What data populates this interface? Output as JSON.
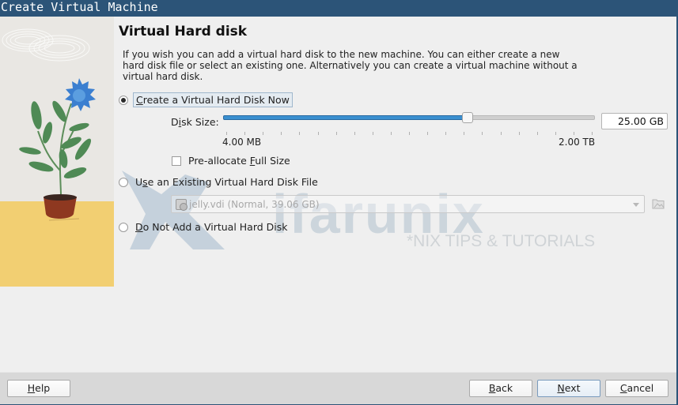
{
  "window": {
    "title": "Create Virtual Machine"
  },
  "page": {
    "title": "Virtual Hard disk",
    "description": "If you wish you can add a virtual hard disk to the new machine. You can either create a new hard disk file or select an existing one. Alternatively you can create a virtual machine without a virtual hard disk."
  },
  "options": {
    "create_new": {
      "label_mnemonic": "C",
      "label_rest": "reate a Virtual Hard Disk Now",
      "selected": true
    },
    "use_existing": {
      "label_pre": "U",
      "label_mnemonic": "s",
      "label_rest": "e an Existing Virtual Hard Disk File",
      "selected": false
    },
    "no_disk": {
      "label_mnemonic": "D",
      "label_rest": "o Not Add a Virtual Hard Disk",
      "selected": false
    }
  },
  "disk_size": {
    "label_pre": "D",
    "label_mnemonic": "i",
    "label_rest": "sk Size:",
    "value": "25.00 GB",
    "slider_fraction": 0.655,
    "min_label": "4.00 MB",
    "max_label": "2.00 TB",
    "tick_count": 20
  },
  "preallocate": {
    "label_pre": "Pre-allocate ",
    "label_mnemonic": "F",
    "label_rest": "ull Size",
    "checked": false
  },
  "existing_disk": {
    "selected": "jelly.vdi (Normal, 39.06 GB)",
    "enabled": false
  },
  "watermark": {
    "brand": "ifarunix",
    "tagline": "*NIX TIPS & TUTORIALS"
  },
  "buttons": {
    "help": {
      "mnemonic": "H",
      "rest": "elp"
    },
    "back": {
      "mnemonic": "B",
      "rest": "ack"
    },
    "next": {
      "mnemonic": "N",
      "rest": "ext"
    },
    "cancel": {
      "mnemonic": "C",
      "rest": "ancel"
    }
  },
  "colors": {
    "titlebar": "#2c5478",
    "slider_fill": "#3a8fd0",
    "flower": "#3b7fd0",
    "floor": "#f2cf72"
  }
}
